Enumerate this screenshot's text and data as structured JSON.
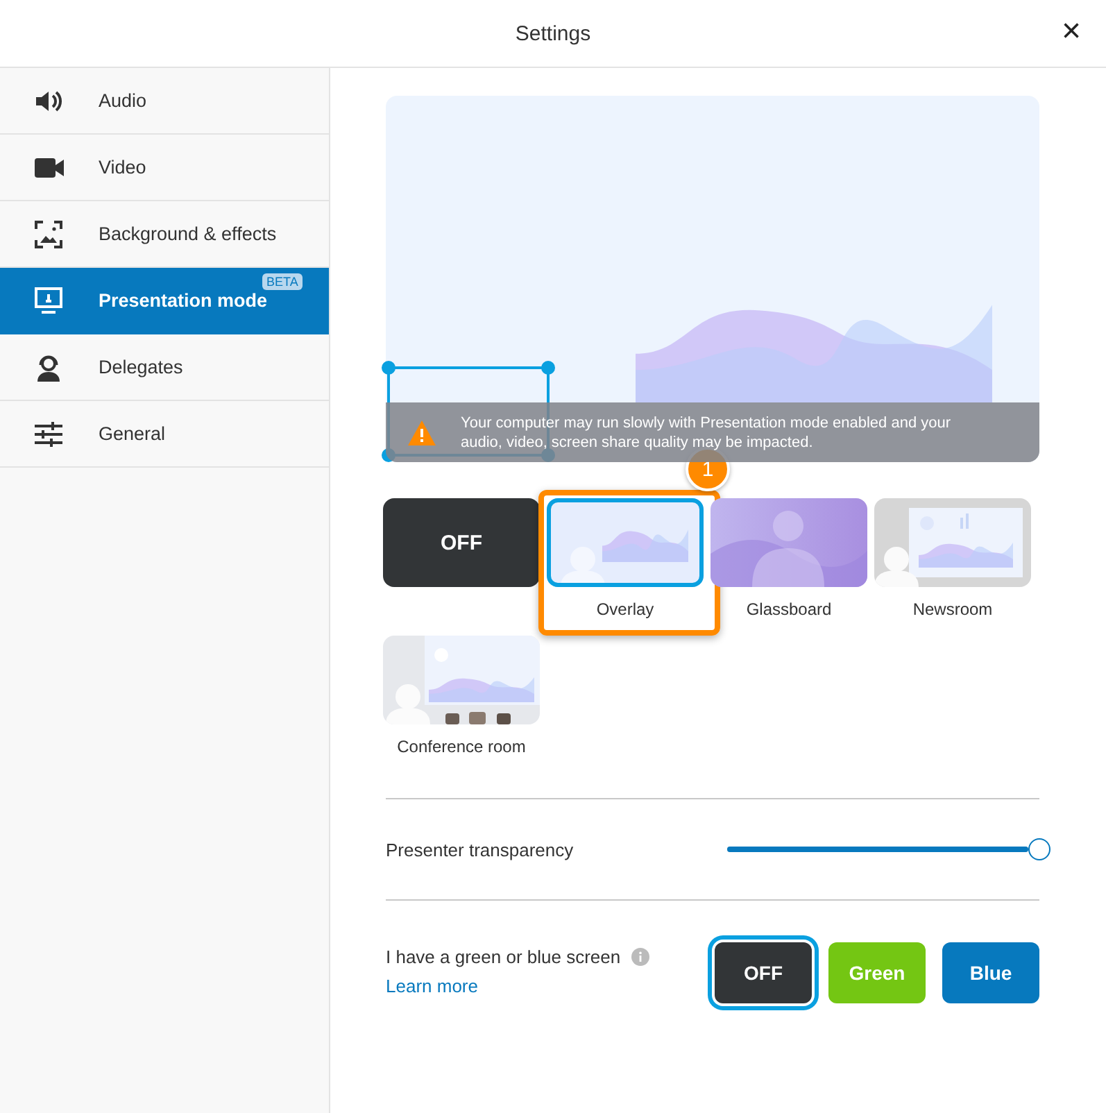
{
  "window": {
    "title": "Settings",
    "close": "×"
  },
  "sidebar": {
    "items": [
      {
        "label": "Audio",
        "selected": false
      },
      {
        "label": "Video",
        "selected": false
      },
      {
        "label": "Background & effects",
        "selected": false
      },
      {
        "label": "Presentation mode",
        "badge": "BETA",
        "selected": true
      },
      {
        "label": "Delegates",
        "selected": false
      },
      {
        "label": "General",
        "selected": false
      }
    ]
  },
  "preview": {
    "warning": "Your computer may run slowly with Presentation mode enabled and your audio, video, screen share quality may be impacted."
  },
  "modes": [
    {
      "kind": "off",
      "label": "OFF",
      "selected": false
    },
    {
      "kind": "overlay",
      "label": "Overlay",
      "selected": true,
      "callout": "1"
    },
    {
      "kind": "glassboard",
      "label": "Glassboard",
      "selected": false
    },
    {
      "kind": "newsroom",
      "label": "Newsroom",
      "selected": false
    },
    {
      "kind": "conference",
      "label": "Conference room",
      "selected": false
    }
  ],
  "transparency": {
    "label": "Presenter transparency",
    "level": 1
  },
  "screen": {
    "label": "I have a green or blue screen",
    "link": "Learn more",
    "options": [
      {
        "label": "OFF",
        "selected": true,
        "color": "#323537"
      },
      {
        "label": "Green",
        "selected": false,
        "color": "#74c613"
      },
      {
        "label": "Blue",
        "selected": false,
        "color": "#0779be"
      }
    ]
  }
}
